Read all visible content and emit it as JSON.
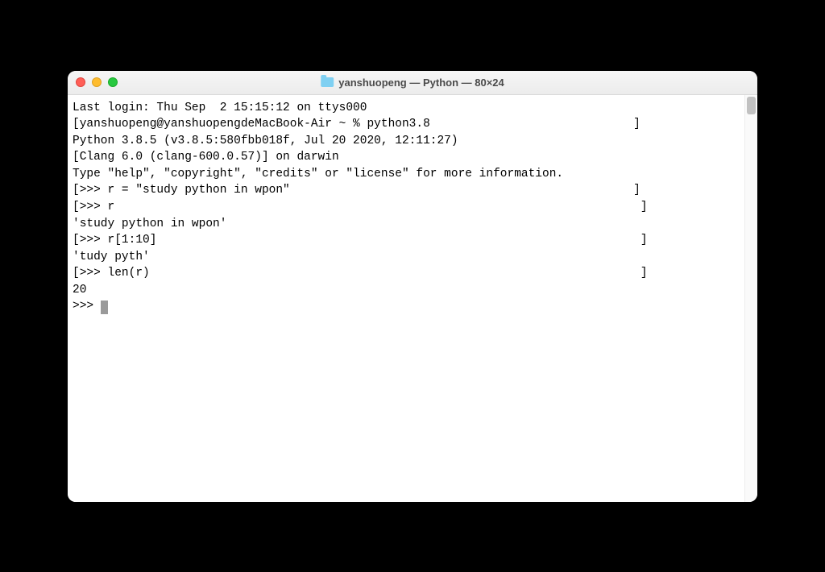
{
  "window": {
    "title": "yanshuopeng — Python — 80×24"
  },
  "terminal": {
    "lines": [
      "Last login: Thu Sep  2 15:15:12 on ttys000",
      "[yanshuopeng@yanshuopengdeMacBook-Air ~ % python3.8                             ]",
      "Python 3.8.5 (v3.8.5:580fbb018f, Jul 20 2020, 12:11:27) ",
      "[Clang 6.0 (clang-600.0.57)] on darwin",
      "Type \"help\", \"copyright\", \"credits\" or \"license\" for more information.",
      "[>>> r = \"study python in wpon\"                                                 ]",
      "[>>> r                                                                           ]",
      "'study python in wpon'",
      "[>>> r[1:10]                                                                     ]",
      "'tudy pyth'",
      "[>>> len(r)                                                                      ]",
      "20",
      ">>> "
    ],
    "prompt": ">>> "
  }
}
